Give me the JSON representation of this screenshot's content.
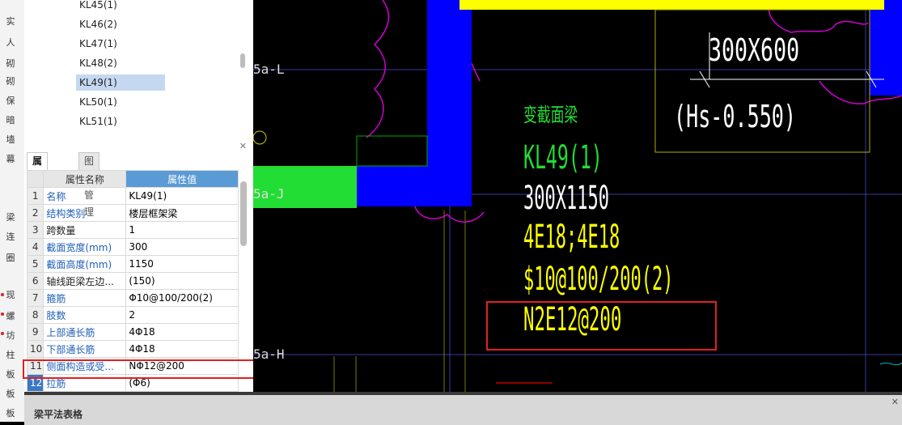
{
  "left_strip": {
    "labels": [
      "实",
      "人",
      "砌",
      "砌",
      "保",
      "暗",
      "墙",
      "幕",
      "梁",
      "连",
      "圈",
      "现",
      "螺",
      "坊",
      "柱",
      "板",
      "板",
      "板"
    ]
  },
  "tree": {
    "items": [
      "KL45(1)",
      "KL46(2)",
      "KL47(1)",
      "KL48(2)",
      "KL49(1)",
      "KL50(1)",
      "KL51(1)"
    ],
    "selected_index": 4
  },
  "property_panel": {
    "tabs": [
      "属性列表",
      "图层管理"
    ],
    "active_tab": 0,
    "header": {
      "name": "属性名称",
      "value": "属性值"
    },
    "close_glyph": "✕",
    "rows": [
      {
        "num": "1",
        "name": "名称",
        "value": "KL49(1)",
        "link": true
      },
      {
        "num": "2",
        "name": "结构类别",
        "value": "楼层框架梁",
        "link": true
      },
      {
        "num": "3",
        "name": "跨数量",
        "value": "1",
        "link": false
      },
      {
        "num": "4",
        "name": "截面宽度(mm)",
        "value": "300",
        "link": true
      },
      {
        "num": "5",
        "name": "截面高度(mm)",
        "value": "1150",
        "link": true
      },
      {
        "num": "6",
        "name": "轴线距梁左边...",
        "value": "(150)",
        "link": false
      },
      {
        "num": "7",
        "name": "箍筋",
        "value": "Φ10@100/200(2)",
        "link": true
      },
      {
        "num": "8",
        "name": "肢数",
        "value": "2",
        "link": true
      },
      {
        "num": "9",
        "name": "上部通长筋",
        "value": "4Φ18",
        "link": true
      },
      {
        "num": "10",
        "name": "下部通长筋",
        "value": "4Φ18",
        "link": true
      },
      {
        "num": "11",
        "name": "侧面构造或受...",
        "value": "NΦ12@200",
        "link": true
      },
      {
        "num": "12",
        "name": "拉筋",
        "value": "(Φ6)",
        "link": true
      }
    ]
  },
  "cad": {
    "axis_labels": [
      "5a-L",
      "5a-J",
      "5a-H"
    ],
    "texts": {
      "size_top": "300X600",
      "elevation": "(Hs-0.550)",
      "variable_section": "变截面梁",
      "beam_name": "KL49(1)",
      "beam_size": "300X1150",
      "long_rebar": "4E18;4E18",
      "stirrup": "$10@100/200(2)",
      "side_rebar": "N2E12@200"
    },
    "colors": {
      "blue": "#0000ff",
      "green": "#22dd33",
      "yellow": "#ffff00",
      "magenta": "#d000d0",
      "highlight_red": "#e02020"
    }
  },
  "bottom_panel": {
    "title": "梁平法表格",
    "close_glyph": "✕"
  }
}
